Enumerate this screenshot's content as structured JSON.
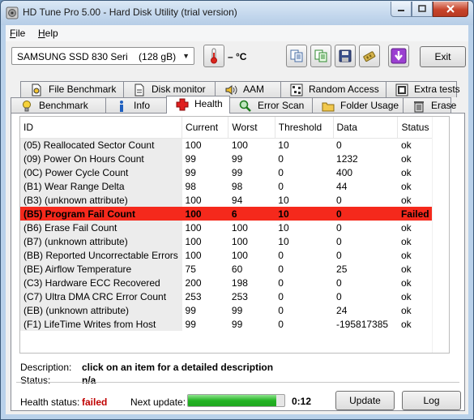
{
  "window": {
    "title": "HD Tune Pro 5.00 - Hard Disk Utility (trial version)"
  },
  "menu": [
    {
      "label": "File",
      "mnemonic": "F",
      "rest": "ile"
    },
    {
      "label": "Help",
      "mnemonic": "H",
      "rest": "elp"
    }
  ],
  "toolbar": {
    "drive": "SAMSUNG SSD 830 Seri    (128 gB)",
    "temperature": "– °C",
    "exit_label": "Exit",
    "icons": [
      "thermometer-icon",
      "copy-icon",
      "copy-all-icon",
      "save-icon",
      "options-icon",
      "download-icon"
    ]
  },
  "tabs_top": [
    {
      "label": "File Benchmark",
      "icon": "file-benchmark-icon"
    },
    {
      "label": "Disk monitor",
      "icon": "disk-monitor-icon"
    },
    {
      "label": "AAM",
      "icon": "speaker-icon"
    },
    {
      "label": "Random Access",
      "icon": "random-access-icon"
    },
    {
      "label": "Extra tests",
      "icon": "extra-tests-icon"
    }
  ],
  "tabs_bottom": [
    {
      "label": "Benchmark",
      "icon": "lightbulb-icon"
    },
    {
      "label": "Info",
      "icon": "info-icon"
    },
    {
      "label": "Health",
      "icon": "red-cross-icon",
      "active": true
    },
    {
      "label": "Error Scan",
      "icon": "magnifier-icon"
    },
    {
      "label": "Folder Usage",
      "icon": "folder-icon"
    },
    {
      "label": "Erase",
      "icon": "trash-icon"
    }
  ],
  "table": {
    "columns": [
      "ID",
      "Current",
      "Worst",
      "Threshold",
      "Data",
      "Status"
    ],
    "rows": [
      [
        "(05) Reallocated Sector Count",
        "100",
        "100",
        "10",
        "0",
        "ok"
      ],
      [
        "(09) Power On Hours Count",
        "99",
        "99",
        "0",
        "1232",
        "ok"
      ],
      [
        "(0C) Power Cycle Count",
        "99",
        "99",
        "0",
        "400",
        "ok"
      ],
      [
        "(B1) Wear Range Delta",
        "98",
        "98",
        "0",
        "44",
        "ok"
      ],
      [
        "(B3) (unknown attribute)",
        "100",
        "94",
        "10",
        "0",
        "ok"
      ],
      [
        "(B5) Program Fail Count",
        "100",
        "6",
        "10",
        "0",
        "Failed"
      ],
      [
        "(B6) Erase Fail Count",
        "100",
        "100",
        "10",
        "0",
        "ok"
      ],
      [
        "(B7) (unknown attribute)",
        "100",
        "100",
        "10",
        "0",
        "ok"
      ],
      [
        "(BB) Reported Uncorrectable Errors",
        "100",
        "100",
        "0",
        "0",
        "ok"
      ],
      [
        "(BE) Airflow Temperature",
        "75",
        "60",
        "0",
        "25",
        "ok"
      ],
      [
        "(C3) Hardware ECC Recovered",
        "200",
        "198",
        "0",
        "0",
        "ok"
      ],
      [
        "(C7) Ultra DMA CRC Error Count",
        "253",
        "253",
        "0",
        "0",
        "ok"
      ],
      [
        "(EB) (unknown attribute)",
        "99",
        "99",
        "0",
        "24",
        "ok"
      ],
      [
        "(F1) LifeTime Writes from Host",
        "99",
        "99",
        "0",
        "-195817385",
        "ok"
      ]
    ],
    "failed_row_color": "#f5291c"
  },
  "details": {
    "description_label": "Description:",
    "description_value": "click on an item for a detailed description",
    "status_label": "Status:",
    "status_value": "n/a"
  },
  "footer": {
    "health_label": "Health status:",
    "health_value": "failed",
    "health_color": "#c00000",
    "next_update_label": "Next update:",
    "progress_fraction": 0.92,
    "timer": "0:12",
    "update_label": "Update",
    "log_label": "Log"
  }
}
